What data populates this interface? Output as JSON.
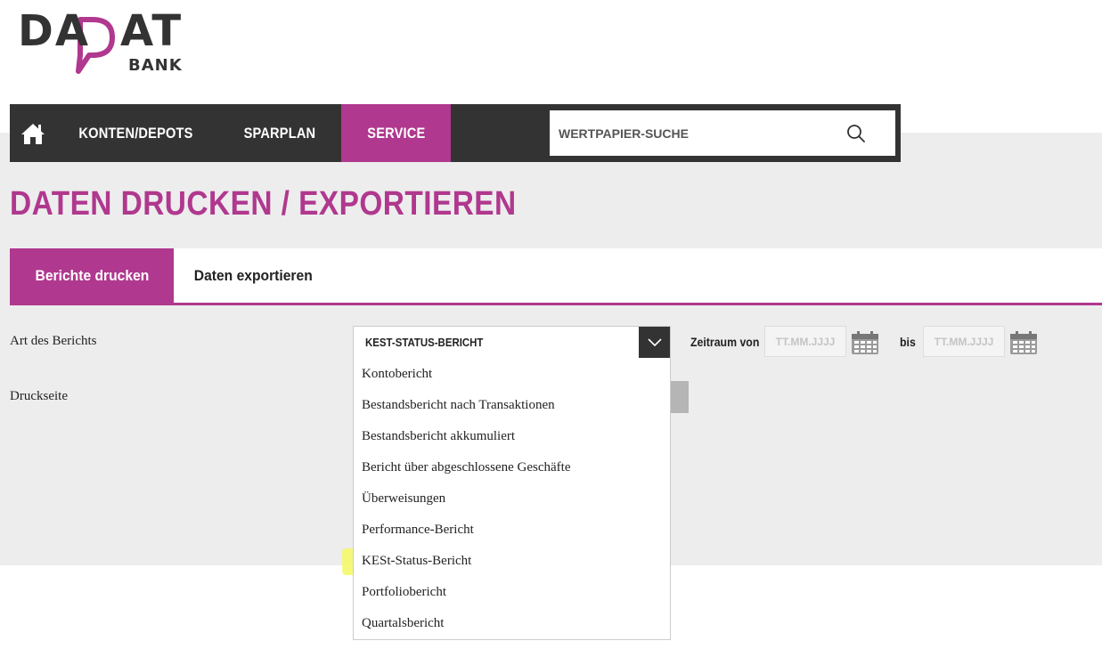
{
  "logo": {
    "main": "DADAT",
    "sub": "BANK"
  },
  "nav": {
    "home_icon": "home-icon",
    "items": [
      {
        "label": "KONTEN/DEPOTS"
      },
      {
        "label": "SPARPLAN"
      },
      {
        "label": "SERVICE",
        "active": true
      }
    ],
    "search_placeholder": "WERTPAPIER-SUCHE",
    "search_icon": "search-icon"
  },
  "page": {
    "title": "DATEN DRUCKEN / EXPORTIEREN"
  },
  "tabs": [
    {
      "label": "Berichte drucken",
      "active": true
    },
    {
      "label": "Daten exportieren",
      "active": false
    }
  ],
  "form": {
    "art_label": "Art des Berichts",
    "druck_label": "Druckseite",
    "select_value": "KEST-STATUS-BERICHT",
    "zeitraum_von_label": "Zeitraum von",
    "bis_label": "bis",
    "date_placeholder": "TT.MM.JJJJ"
  },
  "dropdown": {
    "options": [
      "Kontobericht",
      "Bestandsbericht nach Transaktionen",
      "Bestandsbericht akkumuliert",
      "Bericht über abgeschlossene Geschäfte",
      "Überweisungen",
      "Performance-Bericht",
      "KESt-Status-Bericht",
      "Portfoliobericht",
      "Quartalsbericht"
    ]
  },
  "colors": {
    "brand": "#b0388e",
    "nav_bg": "#333333",
    "highlight": "#f5f76a"
  }
}
